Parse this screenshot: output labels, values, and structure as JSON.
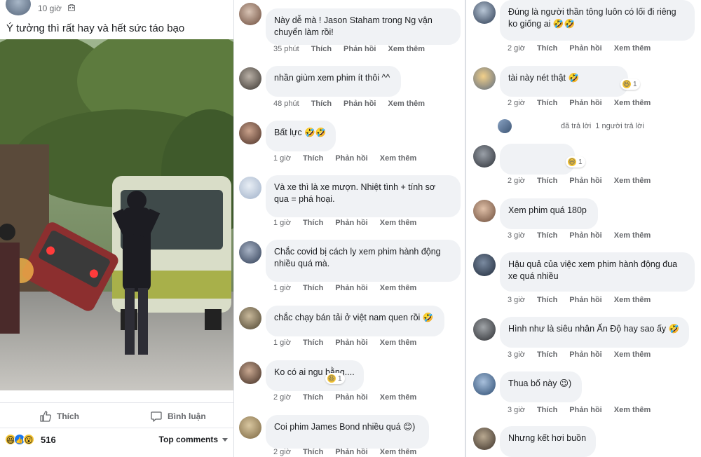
{
  "post": {
    "time": "10 giờ",
    "caption": "Ý tưởng thì rất hay và hết sức táo bạo",
    "actions": {
      "like": "Thích",
      "comment": "Bình luận"
    },
    "reactions": {
      "count": "516",
      "icons": [
        "haha-icon",
        "like-icon",
        "wow-icon"
      ]
    },
    "sort_label": "Top comments"
  },
  "comment_actions": {
    "like": "Thích",
    "reply": "Phản hồi",
    "more": "Xem thêm"
  },
  "middle_comments": [
    {
      "text": "Này dễ mà ! Jason Staham trong Ng vận chuyển làm rồi!",
      "time": "35 phút"
    },
    {
      "text": "nhần giùm xem phim ít thôi ^^",
      "time": "48 phút"
    },
    {
      "text": "Bất lực 🤣🤣",
      "time": "1 giờ"
    },
    {
      "text": "Và xe thì là xe mượn. Nhiệt tình + tính sơ qua = phá hoại.",
      "time": "1 giờ"
    },
    {
      "text": "Chắc covid bị cách ly xem phim hành động nhiều quá mà.",
      "time": "1 giờ"
    },
    {
      "text": "chắc chạy bán tải ở việt nam quen rồi 🤣",
      "time": "1 giờ"
    },
    {
      "text": "Ko có ai ngu bằng....",
      "time": "2 giờ",
      "reaction_count": "1"
    },
    {
      "text": "Coi phim James Bond nhiều quá 😊)",
      "time": "2 giờ"
    }
  ],
  "right_comments": [
    {
      "text": "Đúng là người thần tông luôn có lối đi riêng ko giống ai 🤣🤣",
      "time": "2 giờ"
    },
    {
      "text": "tài này nét thật 🤣",
      "time": "2 giờ",
      "reaction_count": "1"
    },
    {
      "text": "",
      "time": "2 giờ",
      "reaction_count": "1"
    },
    {
      "text": "Xem phim quá 180p",
      "time": "3 giờ"
    },
    {
      "text": "Hậu quả của việc xem phim hành động đua xe quá nhiều",
      "time": "3 giờ"
    },
    {
      "text": "Hình như là siêu nhân Ấn Độ hay sao ấy 🤣",
      "time": "3 giờ"
    },
    {
      "text": "Thua bố này 😉)",
      "time": "3 giờ"
    },
    {
      "text": "Nhưng kết hơi buồn",
      "time": ""
    }
  ],
  "reply_line": {
    "verb": "đã trả lời",
    "count": "1 người trả lời"
  }
}
